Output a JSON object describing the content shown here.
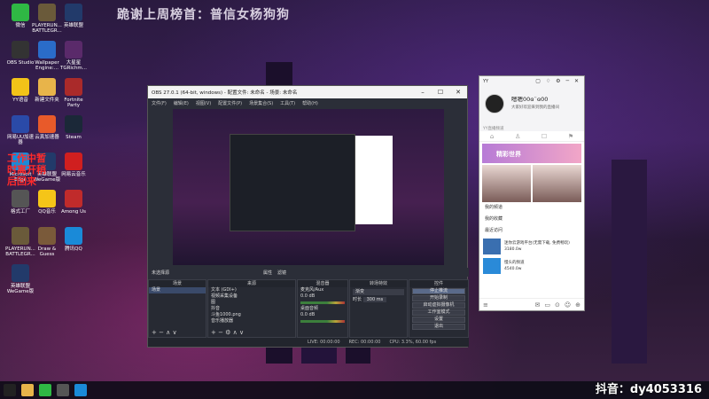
{
  "banner": "跪谢上周榜首：普信女杨狗狗",
  "red_overlay": [
    "工作中暂",
    "时离开稍",
    "后回来"
  ],
  "watermark": "抖音：dy4053316",
  "desktop_icons": [
    {
      "label": "微信",
      "color": "#2fb844"
    },
    {
      "label": "PLAYERUN... BATTLEGR...",
      "color": "#6a5a3a"
    },
    {
      "label": "英雄联盟",
      "color": "#223a6a"
    },
    {
      "label": "OBS Studio",
      "color": "#333"
    },
    {
      "label": "Wallpaper Engine:...",
      "color": "#2a6cc9"
    },
    {
      "label": "大星星 TGRichm...",
      "color": "#5a2a6a"
    },
    {
      "label": "YY语音",
      "color": "#f2c318"
    },
    {
      "label": "新建文件夹",
      "color": "#e8b44a"
    },
    {
      "label": "Fortnite Party",
      "color": "#aa2a2a"
    },
    {
      "label": "网易UU加速器",
      "color": "#2a4aa8"
    },
    {
      "label": "云真加速器",
      "color": "#e85a2a"
    },
    {
      "label": "Steam",
      "color": "#1b2838"
    },
    {
      "label": "Microsoft Edge",
      "color": "#1a8ad8"
    },
    {
      "label": "英雄联盟 WeGame版",
      "color": "#223a6a"
    },
    {
      "label": "网易云音乐",
      "color": "#d01f1f"
    },
    {
      "label": "格式工厂",
      "color": "#555"
    },
    {
      "label": "QQ音乐",
      "color": "#f5c518"
    },
    {
      "label": "Among Us",
      "color": "#c02b2b"
    },
    {
      "label": "PLAYERUN... BATTLEGR...",
      "color": "#6a5a3a"
    },
    {
      "label": "Draw & Guess",
      "color": "#7a5a3a"
    },
    {
      "label": "腾讯QQ",
      "color": "#1a8ad8"
    },
    {
      "label": "英雄联盟 WeGame版",
      "color": "#223a6a"
    }
  ],
  "obs": {
    "title": "OBS 27.0.1 (64-bit, windows) - 配置文件: 未命名 - 场景: 未命名",
    "menu": [
      "文件(F)",
      "编辑(E)",
      "视图(V)",
      "配置文件(P)",
      "场景集合(S)",
      "工具(T)",
      "帮助(H)"
    ],
    "toolbar_label": "未选择源",
    "toolbar_props": "属性",
    "toolbar_filters": "滤镜",
    "docks": {
      "scenes": {
        "header": "场景",
        "items": [
          "场景"
        ]
      },
      "sources": {
        "header": "来源",
        "items": [
          "文本 (GDI+)",
          "视频采集设备",
          "图",
          "抖音",
          "斗鱼1000.png",
          "音乐播放器"
        ]
      },
      "mixer": {
        "header": "混音器",
        "channels": [
          {
            "name": "麦克风/Aux",
            "db": "0.0 dB"
          },
          {
            "name": "桌面音频",
            "db": "0.0 dB"
          }
        ]
      },
      "transitions": {
        "header": "转场特效",
        "type": "渐变",
        "duration_label": "时长",
        "duration": "300 ms"
      },
      "controls": {
        "header": "控件",
        "buttons": [
          "停止推流",
          "开始录制",
          "启动虚拟摄像机",
          "工作室模式",
          "设置",
          "退出"
        ]
      }
    },
    "status": [
      "LIVE: 00:00:00",
      "REC: 00:00:00",
      "CPU: 3.3%, 60.00 fps"
    ]
  },
  "yy": {
    "title": "YY",
    "name": "嗯嗯00ɞ¨ɞ00",
    "signature": "大家好欢迎来到我的直播间",
    "status": "YY直播频道",
    "tabs": [
      "⌂",
      "♙",
      "☐",
      "⚑"
    ],
    "banner": "精彩世界",
    "menu": [
      "我的频道",
      "我的收藏",
      "最近访问"
    ],
    "live_items": [
      {
        "title": "迷你云游戏平台(无需下载, 免费畅玩)",
        "count": "3180.0w"
      },
      {
        "title": "慢头的频道",
        "count": "4540.0w"
      }
    ],
    "bottom_icons": [
      "≡",
      "✉",
      "▭",
      "⊙",
      "☺",
      "⊕"
    ]
  },
  "taskbar": [
    {
      "name": "windows-start",
      "color": "#222"
    },
    {
      "name": "file-explorer",
      "color": "#e8b44a"
    },
    {
      "name": "wechat",
      "color": "#2fb844"
    },
    {
      "name": "obs",
      "color": "#555"
    },
    {
      "name": "edge",
      "color": "#1a8ad8"
    }
  ]
}
